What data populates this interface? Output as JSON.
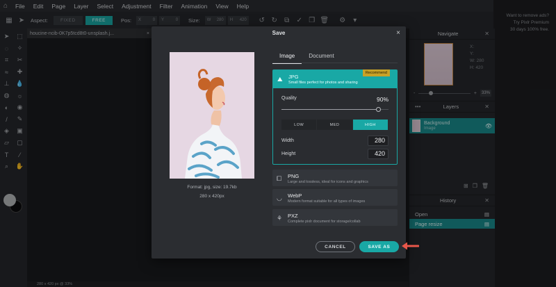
{
  "menu": [
    "File",
    "Edit",
    "Page",
    "Layer",
    "Select",
    "Adjustment",
    "Filter",
    "Animation",
    "View",
    "Help"
  ],
  "options": {
    "aspect_label": "Aspect:",
    "fixed": "FIXED",
    "free": "FREE",
    "pos_label": "Pos:",
    "x_label": "X",
    "x_val": "0",
    "y_label": "Y",
    "y_val": "0",
    "size_label": "Size:",
    "w_label": "W",
    "w_val": "280",
    "h_label": "H",
    "h_val": "420"
  },
  "ad": {
    "line1": "Want to remove ads?",
    "line2": "Try Pixlr Premium",
    "line3": "30 days 100% free."
  },
  "document": {
    "tab_name": "houcine-ncib-0K7p5tcd8t0-unsplash.j...",
    "close": "×",
    "status": "280 x 420 px @ 33%"
  },
  "navigate": {
    "title": "Navigate",
    "x_label": "X:",
    "y_label": "Y:",
    "w_label": "W:",
    "w_val": "280",
    "h_label": "H:",
    "h_val": "420",
    "minus": "-",
    "plus": "+",
    "zoom": "33%"
  },
  "layers": {
    "title": "Layers",
    "dots": "•••",
    "name": "Background",
    "sub": "Image"
  },
  "history": {
    "title": "History",
    "items": [
      "Open",
      "Page resize"
    ]
  },
  "dialog": {
    "title": "Save",
    "close": "×",
    "preview_info": "Format: jpg, size: 19.7kb",
    "preview_dims": "280 x 420px",
    "tabs": [
      "Image",
      "Document"
    ],
    "formats": [
      {
        "name": "JPG",
        "desc": "Small files perfect for photos and sharing",
        "badge": "Recommend"
      },
      {
        "name": "PNG",
        "desc": "Large and lossless, ideal for icons and graphics"
      },
      {
        "name": "WebP",
        "desc": "Modern format suitable for all types of images"
      },
      {
        "name": "PXZ",
        "desc": "Complete pixlr document for storage/collab"
      }
    ],
    "quality_label": "Quality",
    "quality_value": "90%",
    "quality_fraction": 0.9,
    "levels": [
      "LOW",
      "MED",
      "HIGH"
    ],
    "width_label": "Width",
    "width_value": "280",
    "height_label": "Height",
    "height_value": "420",
    "cancel": "CANCEL",
    "save_as": "SAVE AS"
  },
  "colors": {
    "accent": "#19a8a5",
    "badge": "#c9a227",
    "arrow": "#e8574a"
  }
}
